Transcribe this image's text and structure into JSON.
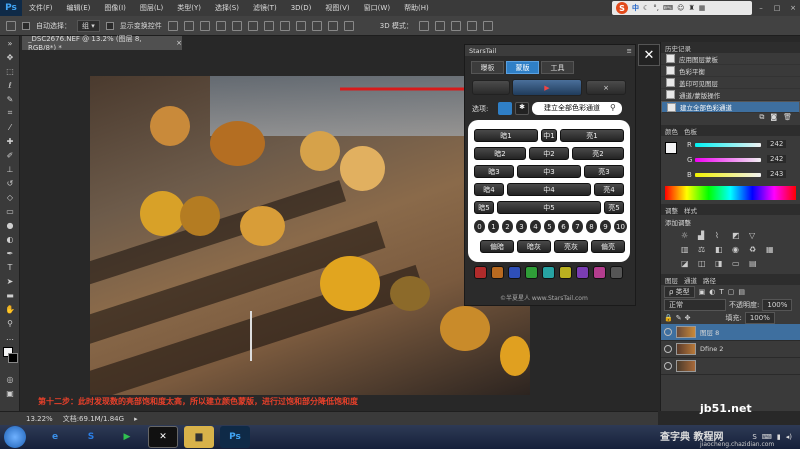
{
  "app": {
    "logo": "Ps"
  },
  "menu": [
    "文件(F)",
    "编辑(E)",
    "图像(I)",
    "图层(L)",
    "类型(Y)",
    "选择(S)",
    "滤镜(T)",
    "3D(D)",
    "视图(V)",
    "窗口(W)",
    "帮助(H)"
  ],
  "ime": {
    "brand": "S",
    "label": "中"
  },
  "options": {
    "auto_select": "自动选择：",
    "group": "组",
    "show_transform": "显示变换控件",
    "mode_3d": "3D 模式："
  },
  "document": {
    "tab": "_DSC2676.NEF @ 13.2% (图层 8, RGB/8*) *"
  },
  "status": {
    "zoom": "13.22%",
    "doc": "文档:69.1M/1.84G"
  },
  "caption": "第十二步：此时发现数的亮部饱和度太高，所以建立颜色蒙版，进行过饱和部分降低饱和度",
  "plugin": {
    "title": "StarsTail",
    "tabs": [
      "曝板",
      "蒙版",
      "工具"
    ],
    "play_icon": "play-icon",
    "close_x": "×",
    "select_label": "选项:",
    "mask_dropdown": "建立全部色彩通道",
    "rows": [
      [
        "暗1",
        "中1",
        "亮1"
      ],
      [
        "暗2",
        "中2",
        "亮2"
      ],
      [
        "暗3",
        "中3",
        "亮3"
      ],
      [
        "暗4",
        "中4",
        "亮4"
      ],
      [
        "暗5",
        "中5",
        "亮5"
      ]
    ],
    "numbers": [
      "0",
      "1",
      "2",
      "3",
      "4",
      "5",
      "6",
      "7",
      "8",
      "9",
      "10"
    ],
    "bottom_buttons": [
      "偏暗",
      "暗灰",
      "亮灰",
      "偏亮"
    ],
    "color_buttons": [
      {
        "label": "红",
        "color": "#b02b2b"
      },
      {
        "label": "橙",
        "color": "#b86a20"
      },
      {
        "label": "黄",
        "color": "#b9b020"
      },
      {
        "label": "绿",
        "color": "#2f9e38"
      },
      {
        "label": "青",
        "color": "#27a3a3"
      },
      {
        "label": "蓝",
        "color": "#2e4fb8"
      },
      {
        "label": "紫",
        "color": "#7a3db3"
      },
      {
        "label": "品",
        "color": "#b33d8e"
      }
    ],
    "footer": "©半夏星人 www.StarsTail.com"
  },
  "history": {
    "title": "历史记录",
    "items": [
      "应用图层蒙板",
      "色彩平衡",
      "盖印可见图层",
      "通道/蒙版操作",
      "建立全部色彩通道"
    ]
  },
  "color_panel": {
    "tabs": [
      "颜色",
      "色板"
    ],
    "r": "242",
    "g": "242",
    "b": "243",
    "r_label": "R",
    "g_label": "G",
    "b_label": "B"
  },
  "adjustments": {
    "tabs": [
      "调整",
      "样式"
    ],
    "title": "添加调整"
  },
  "layers": {
    "tabs": [
      "图层",
      "通道",
      "路径"
    ],
    "kind": "ρ 类型",
    "blend": "正常",
    "opacity_label": "不透明度:",
    "opacity": "100%",
    "fill_label": "填充:",
    "fill": "100%",
    "items": [
      "图层 8",
      "Dfine 2",
      ""
    ]
  },
  "watermark": {
    "site": "jb51.net",
    "cn": "查字典 教程网",
    "url": "jiaocheng.chazidian.com"
  }
}
